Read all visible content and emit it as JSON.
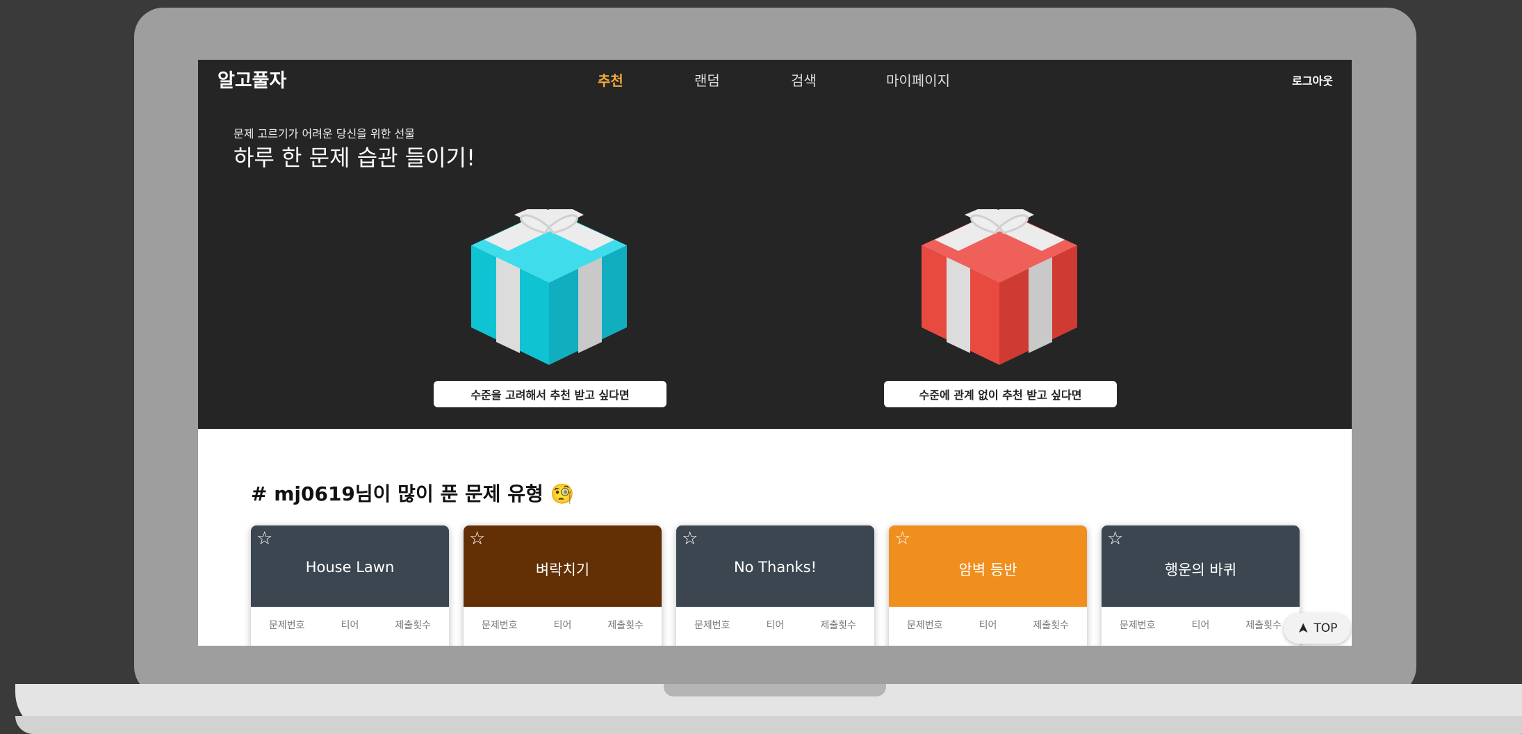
{
  "app": {
    "logo": "알고풀자",
    "logout": "로그아웃"
  },
  "nav": [
    {
      "label": "추천",
      "active": true
    },
    {
      "label": "랜덤",
      "active": false
    },
    {
      "label": "검색",
      "active": false
    },
    {
      "label": "마이페이지",
      "active": false
    }
  ],
  "hero": {
    "subtitle": "문제 고르기가 어려운 당신을 위한 선물",
    "headline": "하루 한 문제 습관 들이기!",
    "gifts": [
      {
        "icon": "gift-box-cyan-icon",
        "button": "수준을 고려해서 추천 받고 싶다면",
        "color": "#19c9d8"
      },
      {
        "icon": "gift-box-red-icon",
        "button": "수준에 관계 없이 추천 받고 싶다면",
        "color": "#e9463f"
      }
    ]
  },
  "section": {
    "title": "# mj0619님이 많이 푼 문제 유형 🧐"
  },
  "cards": [
    {
      "title": "House Lawn",
      "color": "#3c4651"
    },
    {
      "title": "벼락치기",
      "color": "#632f05"
    },
    {
      "title": "No Thanks!",
      "color": "#3c4651"
    },
    {
      "title": "암벽 등반",
      "color": "#f08e1e"
    },
    {
      "title": "행운의 바퀴",
      "color": "#3c4651"
    }
  ],
  "card_columns": [
    "문제번호",
    "티어",
    "제출횟수"
  ],
  "top_button": "TOP",
  "colors": {
    "accent": "#f3a93b",
    "hero_bg": "#252525"
  }
}
